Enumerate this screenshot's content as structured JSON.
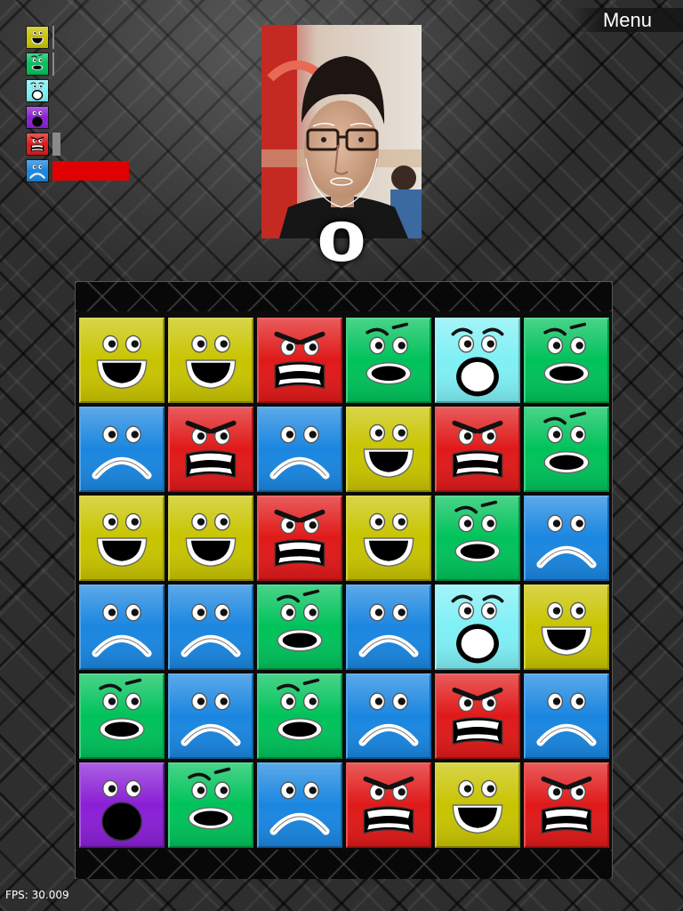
{
  "menu": {
    "label": "Menu"
  },
  "meters": [
    {
      "emotion": "happy",
      "level": 0.02,
      "color": "#c8c400"
    },
    {
      "emotion": "surprised",
      "level": 0.02,
      "color": "#00c25a"
    },
    {
      "emotion": "shocked",
      "level": 0.0,
      "color": "#7ff0f5"
    },
    {
      "emotion": "scared",
      "level": 0.0,
      "color": "#8a1fd6"
    },
    {
      "emotion": "angry",
      "level": 0.08,
      "color": "#e01919"
    },
    {
      "emotion": "sad",
      "level": 0.78,
      "color": "#1a86e0"
    }
  ],
  "meter_bar_colors": {
    "low": "#8a8a8a",
    "high": "#e00000"
  },
  "score": "0",
  "fps": "FPS: 30.009",
  "board": {
    "rows": 6,
    "cols": 6,
    "grid": [
      [
        "happy",
        "happy",
        "angry",
        "surprised",
        "shocked",
        "surprised"
      ],
      [
        "sad",
        "angry",
        "sad",
        "happy",
        "angry",
        "surprised"
      ],
      [
        "happy",
        "happy",
        "angry",
        "happy",
        "surprised",
        "sad"
      ],
      [
        "sad",
        "sad",
        "surprised",
        "sad",
        "shocked",
        "happy"
      ],
      [
        "surprised",
        "sad",
        "surprised",
        "sad",
        "angry",
        "sad"
      ],
      [
        "scared",
        "surprised",
        "sad",
        "angry",
        "happy",
        "angry"
      ]
    ]
  },
  "colors": {
    "happy": "#c8c400",
    "surprised": "#00c25a",
    "shocked": "#7ff0f5",
    "scared": "#8a1fd6",
    "angry": "#e01919",
    "sad": "#1a86e0"
  },
  "icons": {
    "menu": "menu-button",
    "camera": "webcam-feed",
    "tile": "face-tile"
  }
}
